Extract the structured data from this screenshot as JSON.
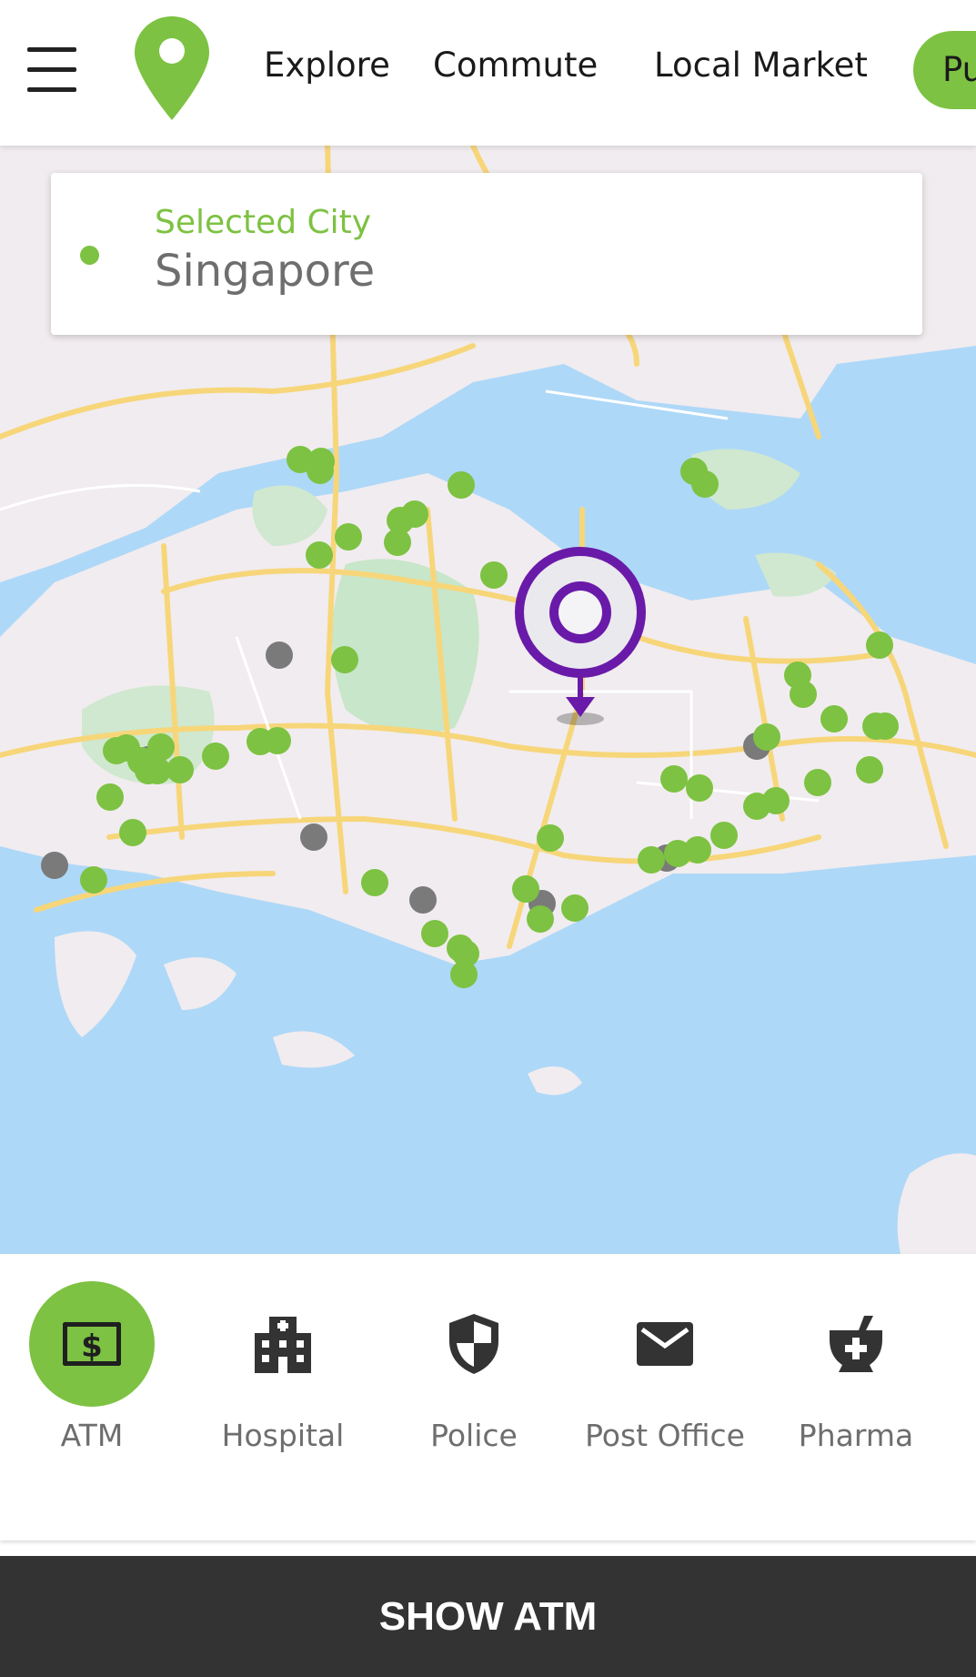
{
  "header": {
    "menu_icon": "hamburger-menu-icon",
    "logo_icon": "location-pin-logo-icon",
    "nav": [
      "Explore",
      "Commute",
      "Local Market",
      "Pu"
    ]
  },
  "city": {
    "label": "Selected City",
    "value": "Singapore"
  },
  "categories": [
    {
      "label": "ATM",
      "icon": "atm-dollar-icon",
      "active": true
    },
    {
      "label": "Hospital",
      "icon": "hospital-building-icon",
      "active": false
    },
    {
      "label": "Police",
      "icon": "shield-icon",
      "active": false
    },
    {
      "label": "Post Office",
      "icon": "envelope-icon",
      "active": false
    },
    {
      "label": "Pharma",
      "icon": "mortar-pestle-icon",
      "active": false
    }
  ],
  "show_button": "SHOW ATM",
  "colors": {
    "accent": "#7dc242",
    "marker_inactive": "#7a7a7a",
    "location_marker": "#6a1aa8",
    "bottom_button": "#333333"
  }
}
